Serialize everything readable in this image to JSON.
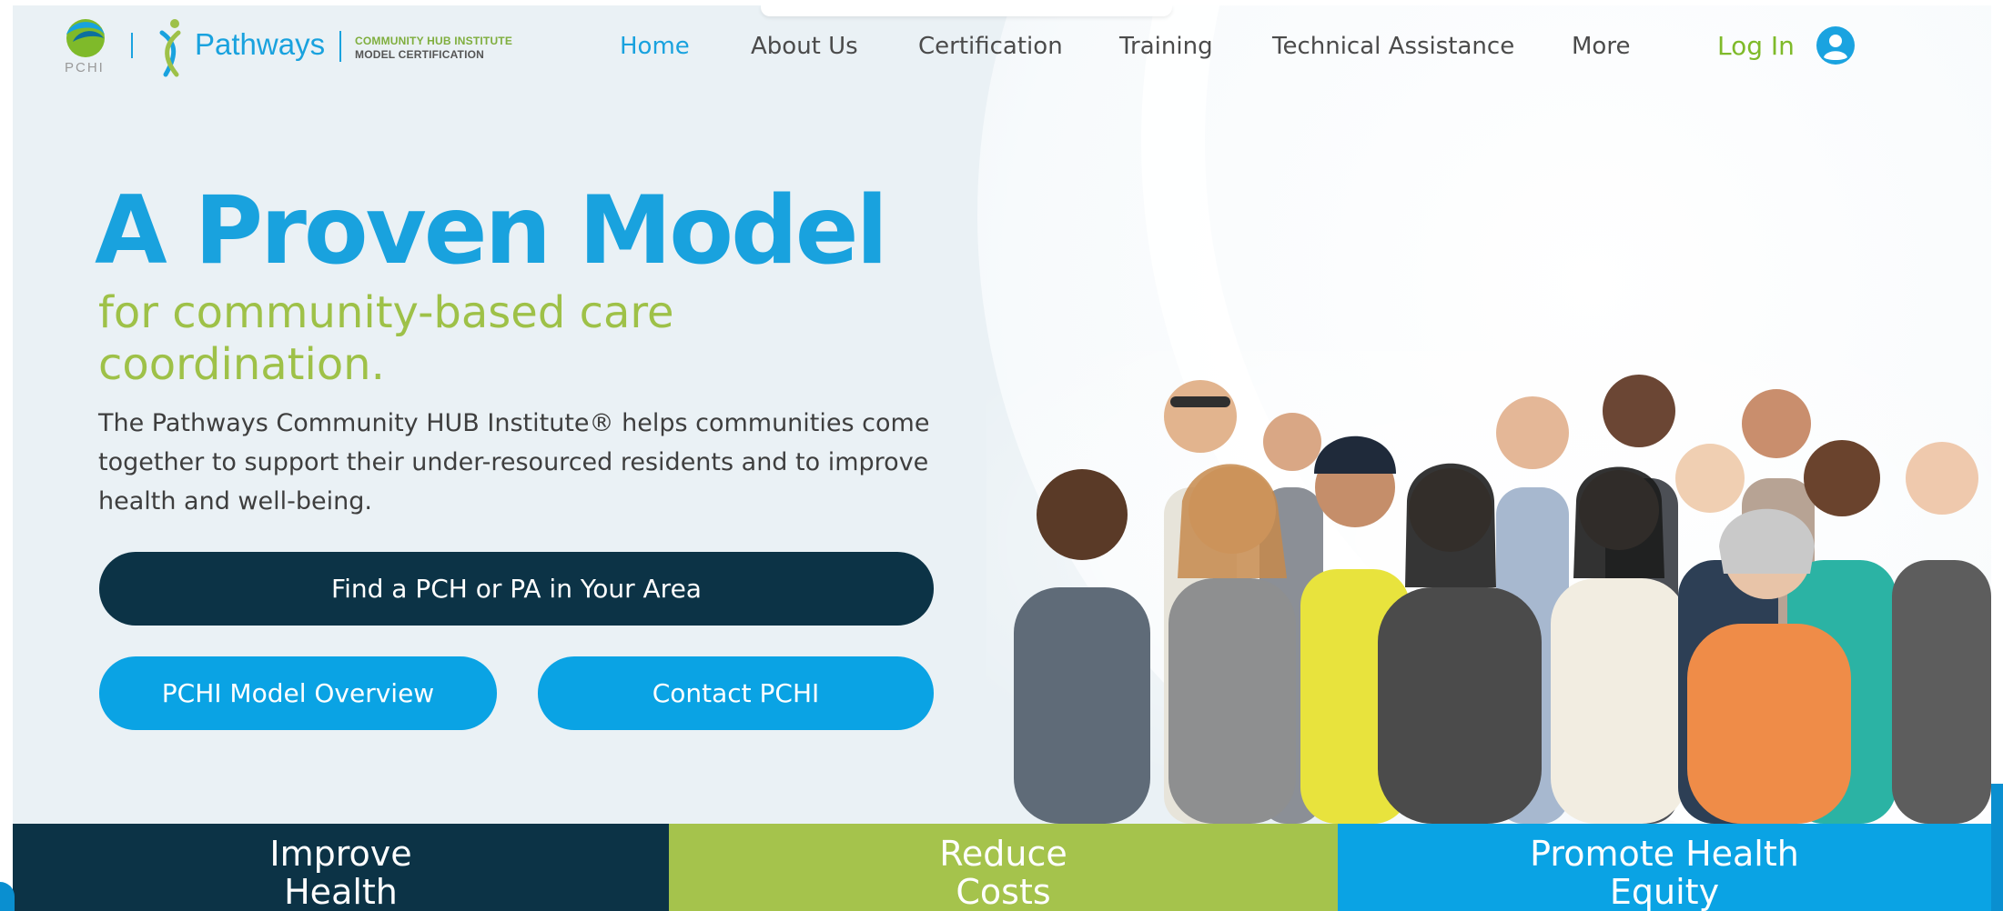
{
  "header": {
    "logo_pchi": "PCHI",
    "logo_pathways": "Pathways",
    "tagline_line1": "COMMUNITY HUB INSTITUTE",
    "tagline_line2": "MODEL CERTIFICATION",
    "nav": [
      {
        "label": "Home",
        "active": true
      },
      {
        "label": "About Us"
      },
      {
        "label": "Certification"
      },
      {
        "label": "Training"
      },
      {
        "label": "Technical Assistance"
      },
      {
        "label": "More"
      }
    ],
    "login_label": "Log In"
  },
  "hero": {
    "title": "A Proven Model",
    "subtitle": "for community-based care coordination.",
    "description": "The Pathways Community HUB Institute® helps communities come together to support their under-resourced residents and to improve health and well-being.",
    "buttons": {
      "find": "Find a PCH or PA in Your Area",
      "overview": "PCHI Model Overview",
      "contact": "Contact PCHI"
    }
  },
  "bands": [
    {
      "line1": "Improve",
      "line2": "Health"
    },
    {
      "line1": "Reduce",
      "line2": "Costs"
    },
    {
      "line1": "Promote Health",
      "line2": "Equity"
    }
  ],
  "colors": {
    "primary_blue": "#19a2de",
    "accent_green": "#9ec148",
    "dark_navy": "#0c3346",
    "band_green": "#a5c34c",
    "band_blue": "#0aa3e4"
  }
}
